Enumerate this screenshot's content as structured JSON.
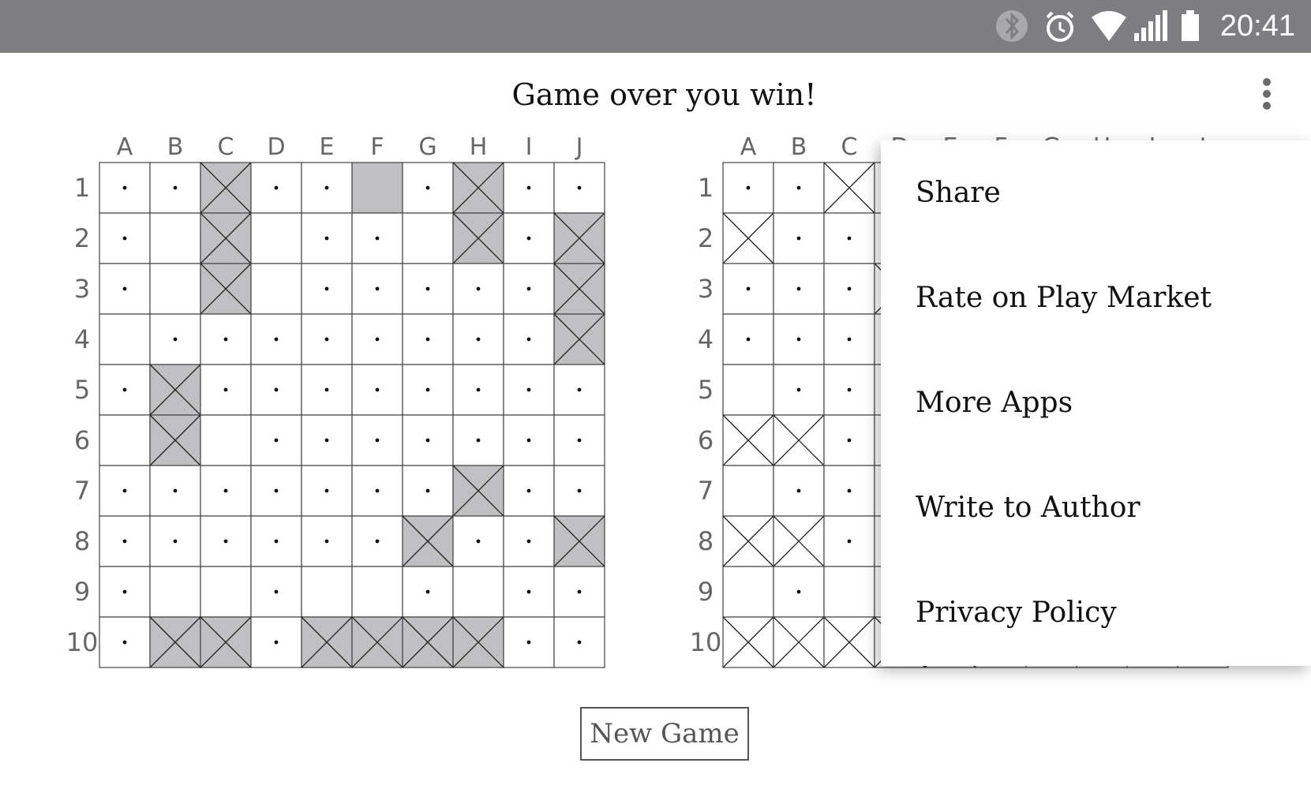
{
  "status_bar": {
    "time": "20:41",
    "icons": [
      "bluetooth-icon",
      "alarm-icon",
      "wifi-icon",
      "cell-signal-icon",
      "battery-icon"
    ],
    "background": "#7e7d82"
  },
  "title": "Game over you win!",
  "menu": {
    "items": [
      "Share",
      "Rate on Play Market",
      "More Apps",
      "Write to Author",
      "Privacy Policy"
    ]
  },
  "new_game_label": "New Game",
  "columns": [
    "A",
    "B",
    "C",
    "D",
    "E",
    "F",
    "G",
    "H",
    "I",
    "J"
  ],
  "rows": [
    "1",
    "2",
    "3",
    "4",
    "5",
    "6",
    "7",
    "8",
    "9",
    "10"
  ],
  "colors": {
    "ship_fill": "#c0bfc2",
    "grid_line": "#444444",
    "label": "#666666"
  },
  "boards": {
    "left": {
      "legend": "H = hit ship cell (grey with X), S = ship cell grey, M = miss dot, E = empty",
      "cells": [
        "MMHMMSMHMM",
        "MEHEMMEHMH",
        "MEHEMMMMMH",
        "EMMMMMMMMH",
        "MHMMMMMMMM",
        "EHEMMMMMMM",
        "MMMMMMMHMM",
        "MMMMMMHMMH",
        "MEEMEEMEMM",
        "MHHMHHHHMM"
      ]
    },
    "right": {
      "legend": "X = hit cell (white with X), M = miss dot, E = empty",
      "cells": [
        "MMXEEEEEEE",
        "XMMEEEEEEE",
        "MMMXEEEEEE",
        "MMMEEEEEEE",
        "EMMEEEEEEE",
        "XXMEEEEEEE",
        "EMMEEEEEEE",
        "XXMEEEEEEE",
        "EMEEEEEEEE",
        "XXXXXEEEEE"
      ]
    }
  }
}
